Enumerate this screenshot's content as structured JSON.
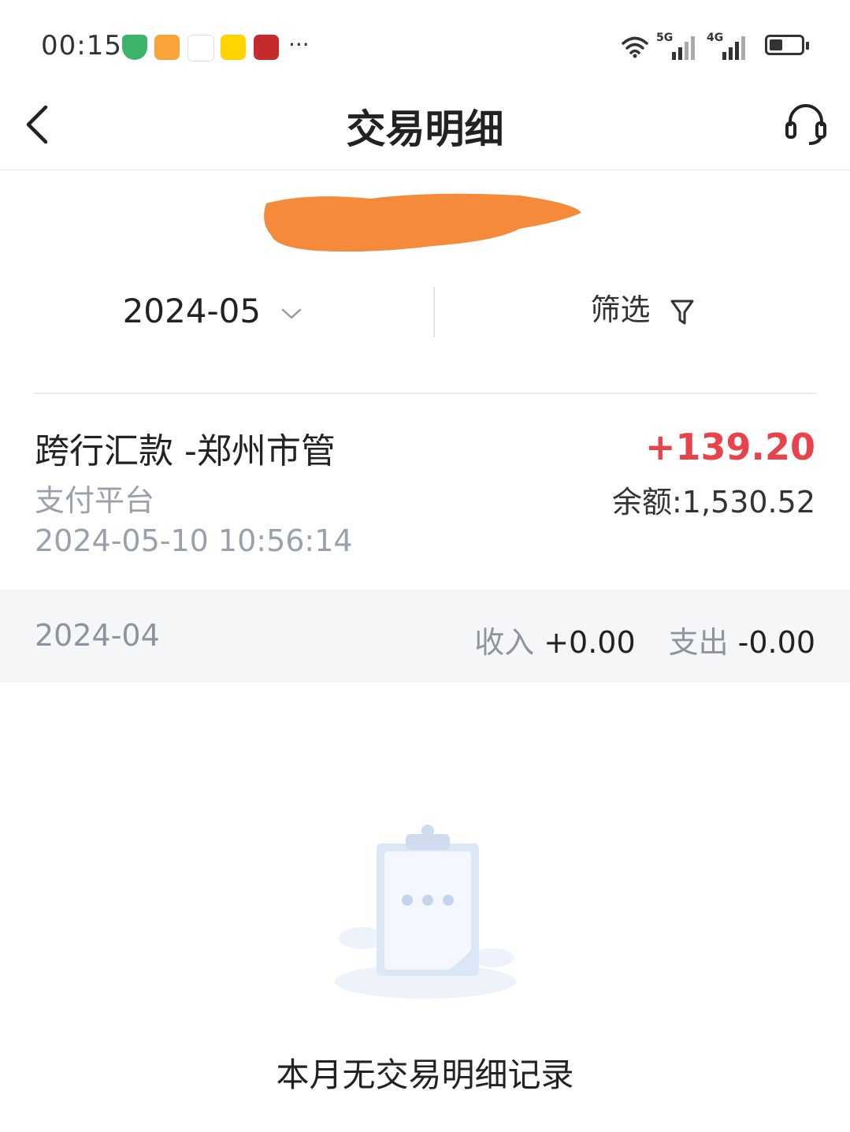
{
  "status_bar": {
    "time": "00:15",
    "more": "···",
    "net_5g": "5G",
    "net_4g": "4G"
  },
  "header": {
    "title": "交易明细"
  },
  "filter": {
    "month": "2024-05",
    "filter_label": "筛选"
  },
  "transactions": [
    {
      "title": "跨行汇款 -郑州市管",
      "channel": "支付平台",
      "datetime": "2024-05-10 10:56:14",
      "amount": "+139.20",
      "balance": "余额:1,530.52"
    }
  ],
  "month_summary": {
    "month": "2024-04",
    "income_label": "收入",
    "income_value": "+0.00",
    "expense_label": "支出",
    "expense_value": "-0.00"
  },
  "empty_state": {
    "message": "本月无交易明细记录"
  },
  "colors": {
    "amount_positive": "#e8434a",
    "muted_text": "#9aa1ad",
    "summary_bg": "#f5f6f8",
    "redaction": "#f58b3a"
  }
}
